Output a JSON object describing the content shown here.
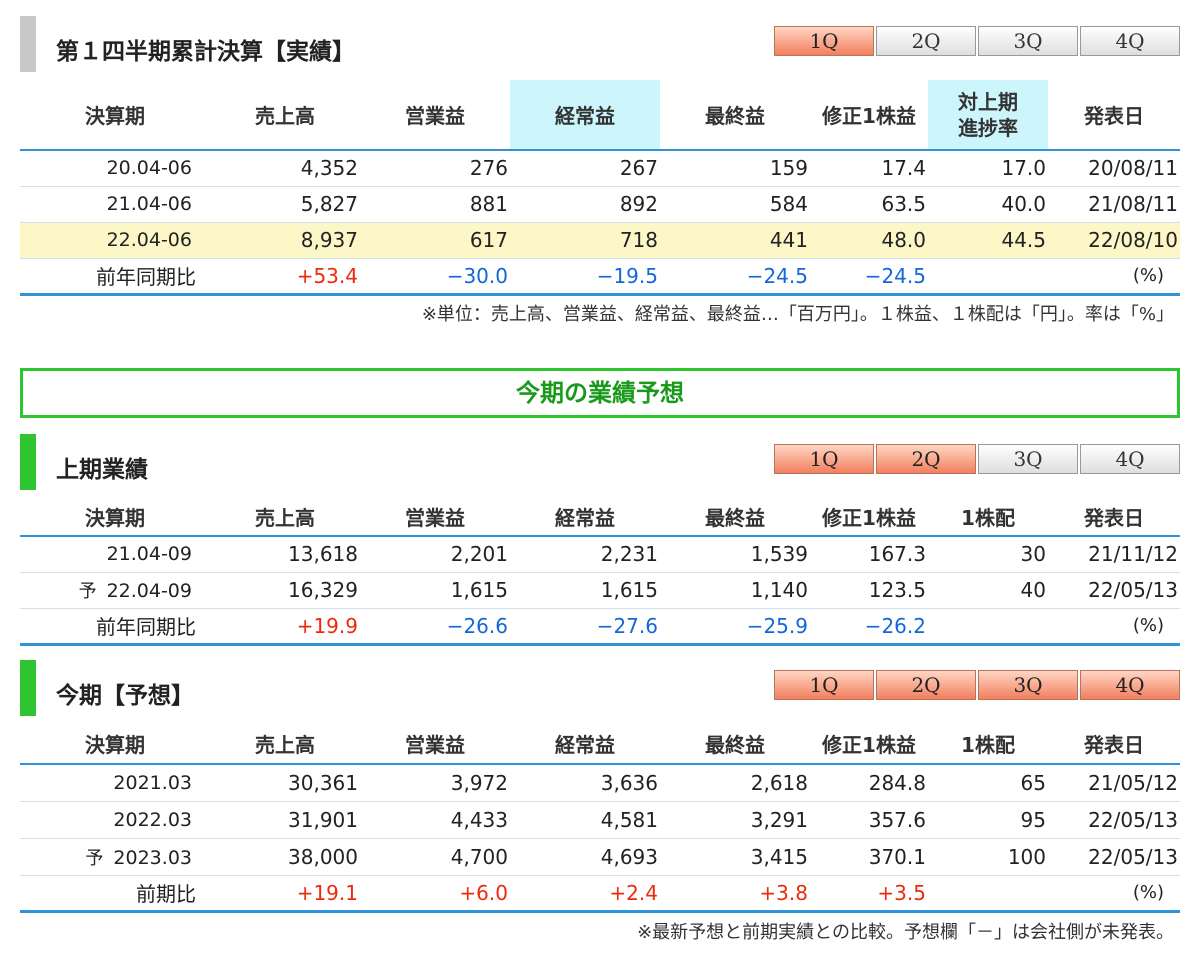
{
  "section1": {
    "title": "第１四半期累計決算【実績】",
    "tabs": [
      "1Q",
      "2Q",
      "3Q",
      "4Q"
    ],
    "active_tabs": [
      true,
      false,
      false,
      false
    ],
    "headers": [
      "決算期",
      "売上高",
      "営業益",
      "経常益",
      "最終益",
      "修正1株益",
      "対上期進捗率",
      "発表日"
    ],
    "header_progress_line1": "対上期",
    "header_progress_line2": "進捗率",
    "rows": [
      {
        "period": "20.04-06",
        "sales": "4,352",
        "op": "276",
        "ord": "267",
        "net": "159",
        "eps": "17.4",
        "progress": "17.0",
        "date": "20/08/11"
      },
      {
        "period": "21.04-06",
        "sales": "5,827",
        "op": "881",
        "ord": "892",
        "net": "584",
        "eps": "63.5",
        "progress": "40.0",
        "date": "21/08/11"
      },
      {
        "period": "22.04-06",
        "sales": "8,937",
        "op": "617",
        "ord": "718",
        "net": "441",
        "eps": "48.0",
        "progress": "44.5",
        "date": "22/08/10"
      }
    ],
    "ratio_label": "前年同期比",
    "ratio": {
      "sales": "+53.4",
      "op": "−30.0",
      "ord": "−19.5",
      "net": "−24.5",
      "eps": "−24.5"
    },
    "unit": "(%)",
    "note": "※単位：売上高、営業益、経常益、最終益…「百万円」。１株益、１株配は「円」。率は「%」"
  },
  "forecast_banner": "今期の業績予想",
  "section2": {
    "title": "上期業績",
    "tabs": [
      "1Q",
      "2Q",
      "3Q",
      "4Q"
    ],
    "active_tabs": [
      true,
      true,
      false,
      false
    ],
    "headers": [
      "決算期",
      "売上高",
      "営業益",
      "経常益",
      "最終益",
      "修正1株益",
      "1株配",
      "発表日"
    ],
    "rows": [
      {
        "yo": "",
        "period": "21.04-09",
        "sales": "13,618",
        "op": "2,201",
        "ord": "2,231",
        "net": "1,539",
        "eps": "167.3",
        "div": "30",
        "date": "21/11/12"
      },
      {
        "yo": "予",
        "period": "22.04-09",
        "sales": "16,329",
        "op": "1,615",
        "ord": "1,615",
        "net": "1,140",
        "eps": "123.5",
        "div": "40",
        "date": "22/05/13"
      }
    ],
    "ratio_label": "前年同期比",
    "ratio": {
      "sales": "+19.9",
      "op": "−26.6",
      "ord": "−27.6",
      "net": "−25.9",
      "eps": "−26.2"
    },
    "unit": "(%)"
  },
  "section3": {
    "title": "今期【予想】",
    "tabs": [
      "1Q",
      "2Q",
      "3Q",
      "4Q"
    ],
    "active_tabs": [
      true,
      true,
      true,
      true
    ],
    "headers": [
      "決算期",
      "売上高",
      "営業益",
      "経常益",
      "最終益",
      "修正1株益",
      "1株配",
      "発表日"
    ],
    "rows": [
      {
        "yo": "",
        "period": "2021.03",
        "sales": "30,361",
        "op": "3,972",
        "ord": "3,636",
        "net": "2,618",
        "eps": "284.8",
        "div": "65",
        "date": "21/05/12"
      },
      {
        "yo": "",
        "period": "2022.03",
        "sales": "31,901",
        "op": "4,433",
        "ord": "4,581",
        "net": "3,291",
        "eps": "357.6",
        "div": "95",
        "date": "22/05/13"
      },
      {
        "yo": "予",
        "period": "2023.03",
        "sales": "38,000",
        "op": "4,700",
        "ord": "4,693",
        "net": "3,415",
        "eps": "370.1",
        "div": "100",
        "date": "22/05/13"
      }
    ],
    "ratio_label": "前期比",
    "ratio": {
      "sales": "+19.1",
      "op": "+6.0",
      "ord": "+2.4",
      "net": "+3.8",
      "eps": "+3.5"
    },
    "unit": "(%)",
    "note": "※最新予想と前期実績との比較。予想欄「－」は会社側が未発表。"
  },
  "colors": {
    "gray_bar": "#c8c8c8",
    "green_bar": "#2ec52e",
    "positive": "#ee2a0a",
    "negative": "#1367d8",
    "accent_line": "#3393d8"
  }
}
